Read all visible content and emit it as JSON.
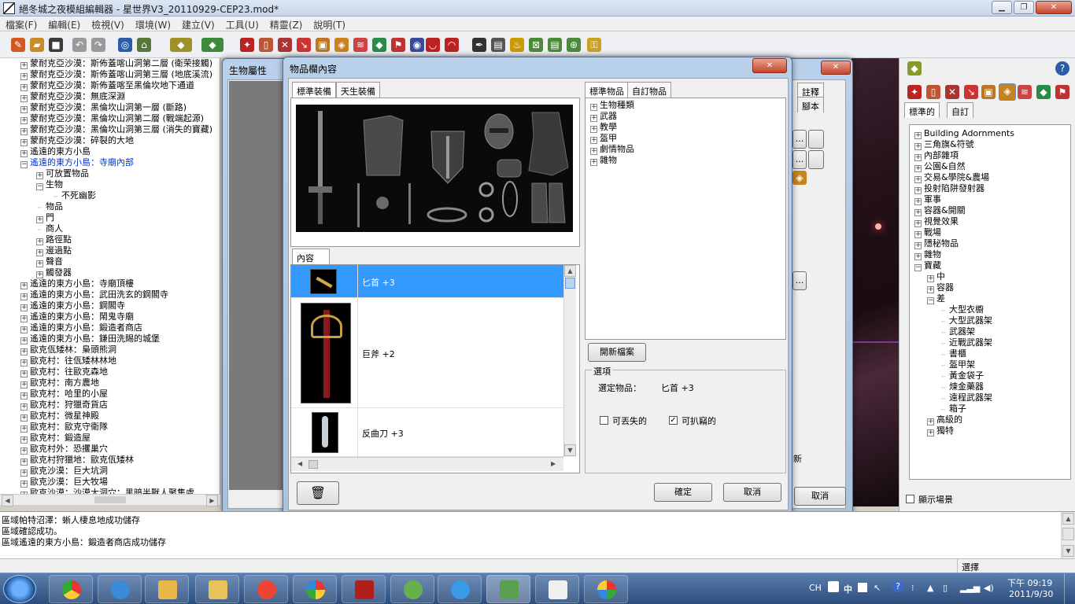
{
  "window": {
    "title": "絕冬城之夜模組編輯器 - 星世界V3_20110929-CEP23.mod*"
  },
  "menu": [
    "檔案(F)",
    "編輯(E)",
    "檢視(V)",
    "環境(W)",
    "建立(V)",
    "工具(U)",
    "精靈(Z)",
    "說明(T)"
  ],
  "left_tree": [
    {
      "t": "蒙耐克亞沙漠：斯佈蓋喀山洞第二層 (衛荣接觸)",
      "d": 0,
      "pm": "+"
    },
    {
      "t": "蒙耐克亞沙漠：斯佈蓋喀山洞第三層 (地底溪流)",
      "d": 0,
      "pm": "+"
    },
    {
      "t": "蒙耐克亞沙漠：斯佈蓋喀至黑倫坎地下通道",
      "d": 0,
      "pm": "+"
    },
    {
      "t": "蒙耐克亞沙漠：無底深淵",
      "d": 0,
      "pm": "+"
    },
    {
      "t": "蒙耐克亞沙漠：黑倫坎山洞第一層 (斷路)",
      "d": 0,
      "pm": "+"
    },
    {
      "t": "蒙耐克亞沙漠：黑倫坎山洞第二層 (戰端起源)",
      "d": 0,
      "pm": "+"
    },
    {
      "t": "蒙耐克亞沙漠：黑倫坎山洞第三層 (消失的寶藏)",
      "d": 0,
      "pm": "+"
    },
    {
      "t": "蒙耐克亞沙漠：碎裂的大地",
      "d": 0,
      "pm": "+"
    },
    {
      "t": "遙遠的東方小島",
      "d": 0,
      "pm": "+"
    },
    {
      "t": "遙遠的東方小島：寺廟內部",
      "d": 0,
      "pm": "−",
      "sel": true
    },
    {
      "t": "可放置物品",
      "d": 1,
      "pm": "+"
    },
    {
      "t": "生物",
      "d": 1,
      "pm": "−"
    },
    {
      "t": "不死幽影",
      "d": 2,
      "pm": ""
    },
    {
      "t": "物品",
      "d": 1,
      "pm": ""
    },
    {
      "t": "門",
      "d": 1,
      "pm": "+"
    },
    {
      "t": "商人",
      "d": 1,
      "pm": ""
    },
    {
      "t": "路徑點",
      "d": 1,
      "pm": "+"
    },
    {
      "t": "邊過點",
      "d": 1,
      "pm": "+"
    },
    {
      "t": "聲音",
      "d": 1,
      "pm": "+"
    },
    {
      "t": "觸發器",
      "d": 1,
      "pm": "+"
    },
    {
      "t": "遙遠的東方小島：寺廟頂樓",
      "d": 0,
      "pm": "+"
    },
    {
      "t": "遙遠的東方小島：武田洗玄的鋼閣寺",
      "d": 0,
      "pm": "+"
    },
    {
      "t": "遙遠的東方小島：鋼閣寺",
      "d": 0,
      "pm": "+"
    },
    {
      "t": "遙遠的東方小島：鬧鬼寺廟",
      "d": 0,
      "pm": "+"
    },
    {
      "t": "遙遠的東方小島：鍛造者商店",
      "d": 0,
      "pm": "+"
    },
    {
      "t": "遙遠的東方小島：鎌田洗賜的城堡",
      "d": 0,
      "pm": "+"
    },
    {
      "t": "歐克佤矮林：梟頭熊洞",
      "d": 0,
      "pm": "+"
    },
    {
      "t": "歐克村：往佤矮林林地",
      "d": 0,
      "pm": "+"
    },
    {
      "t": "歐克村：往歐克森地",
      "d": 0,
      "pm": "+"
    },
    {
      "t": "歐克村：南方農地",
      "d": 0,
      "pm": "+"
    },
    {
      "t": "歐克村：哈里的小屋",
      "d": 0,
      "pm": "+"
    },
    {
      "t": "歐克村：狩獵奇貨店",
      "d": 0,
      "pm": "+"
    },
    {
      "t": "歐克村：微星神殿",
      "d": 0,
      "pm": "+"
    },
    {
      "t": "歐克村：歐克守衛隊",
      "d": 0,
      "pm": "+"
    },
    {
      "t": "歐克村：鍛造屋",
      "d": 0,
      "pm": "+"
    },
    {
      "t": "歐克村外：恐攫巢穴",
      "d": 0,
      "pm": "+"
    },
    {
      "t": "歐克村狩獵地：歐克佤矮林",
      "d": 0,
      "pm": "+"
    },
    {
      "t": "歐克沙漠：巨大坑洞",
      "d": 0,
      "pm": "+"
    },
    {
      "t": "歐克沙漠：巨大牧場",
      "d": 0,
      "pm": "+"
    },
    {
      "t": "歐克沙漠：沙漠大洞穴：黑暗半獸人聚集處",
      "d": 0,
      "pm": "+"
    }
  ],
  "log": [
    "區域帕特沼澤：蜥人棲息地成功儲存",
    "區域確認成功。",
    "區域遙遠的東方小島：鍛造者商店成功儲存"
  ],
  "status": {
    "right": "選擇"
  },
  "bg_dialog": {
    "title": "生物屬性",
    "close": "✕",
    "tabs": [
      "註釋",
      "腳本"
    ],
    "cancel": "取消",
    "small_btn": "...",
    "partial_text": "新"
  },
  "dialog": {
    "title": "物品欄內容",
    "close": "✕",
    "equip_tabs": [
      "標準裝備",
      "天生裝備"
    ],
    "content_tab": "內容",
    "items": [
      {
        "name": "匕首 +3",
        "sel": true,
        "icon": "dagger-icon"
      },
      {
        "name": "巨斧 +2",
        "sel": false,
        "icon": "halberd-icon"
      },
      {
        "name": "反曲刀 +3",
        "sel": false,
        "icon": "scimitar-icon"
      }
    ],
    "palette_tabs": [
      "標準物品",
      "自訂物品"
    ],
    "palette_tree": [
      "生物種類",
      "武器",
      "教學",
      "盔甲",
      "劇情物品",
      "雜物"
    ],
    "open_file": "開新檔案",
    "options": {
      "label": "選項",
      "selected_label": "選定物品：",
      "selected_value": "匕首 +3",
      "droppable": "可丟失的",
      "pickpocketable": "可扒竊的",
      "droppable_checked": false,
      "pickpocketable_checked": true
    },
    "ok": "確定",
    "cancel": "取消"
  },
  "right_panel": {
    "tabs": [
      "標準的",
      "自訂"
    ],
    "tree": [
      {
        "t": "Building Adornments",
        "d": 0,
        "pm": "+"
      },
      {
        "t": "三角旗&符號",
        "d": 0,
        "pm": "+"
      },
      {
        "t": "內部雜項",
        "d": 0,
        "pm": "+"
      },
      {
        "t": "公園&自然",
        "d": 0,
        "pm": "+"
      },
      {
        "t": "交易&學院&農場",
        "d": 0,
        "pm": "+"
      },
      {
        "t": "投射陷阱發射器",
        "d": 0,
        "pm": "+"
      },
      {
        "t": "軍事",
        "d": 0,
        "pm": "+"
      },
      {
        "t": "容器&開關",
        "d": 0,
        "pm": "+"
      },
      {
        "t": "視覺效果",
        "d": 0,
        "pm": "+"
      },
      {
        "t": "戰場",
        "d": 0,
        "pm": "+"
      },
      {
        "t": "隱秘物品",
        "d": 0,
        "pm": "+"
      },
      {
        "t": "雜物",
        "d": 0,
        "pm": "+"
      },
      {
        "t": "寶藏",
        "d": 0,
        "pm": "−"
      },
      {
        "t": "中",
        "d": 1,
        "pm": "+"
      },
      {
        "t": "容器",
        "d": 1,
        "pm": "+"
      },
      {
        "t": "差",
        "d": 1,
        "pm": "−"
      },
      {
        "t": "大型衣櫥",
        "d": 2,
        "pm": ""
      },
      {
        "t": "大型武器架",
        "d": 2,
        "pm": ""
      },
      {
        "t": "武器架",
        "d": 2,
        "pm": ""
      },
      {
        "t": "近戰武器架",
        "d": 2,
        "pm": ""
      },
      {
        "t": "書櫃",
        "d": 2,
        "pm": ""
      },
      {
        "t": "盔甲架",
        "d": 2,
        "pm": ""
      },
      {
        "t": "黃金袋子",
        "d": 2,
        "pm": ""
      },
      {
        "t": "煉金藥器",
        "d": 2,
        "pm": ""
      },
      {
        "t": "遠程武器架",
        "d": 2,
        "pm": ""
      },
      {
        "t": "箱子",
        "d": 2,
        "pm": ""
      },
      {
        "t": "高級的",
        "d": 1,
        "pm": "+"
      },
      {
        "t": "獨特",
        "d": 1,
        "pm": "+"
      }
    ],
    "show_scene": "顯示場景"
  },
  "taskbar": {
    "lang": "CH",
    "ime": "中",
    "time": "下午 09:19",
    "date": "2011/9/30"
  },
  "colors": {
    "accent": "#3399ff",
    "taskbar": "#2c4d7c",
    "selection": "#3399ff"
  }
}
